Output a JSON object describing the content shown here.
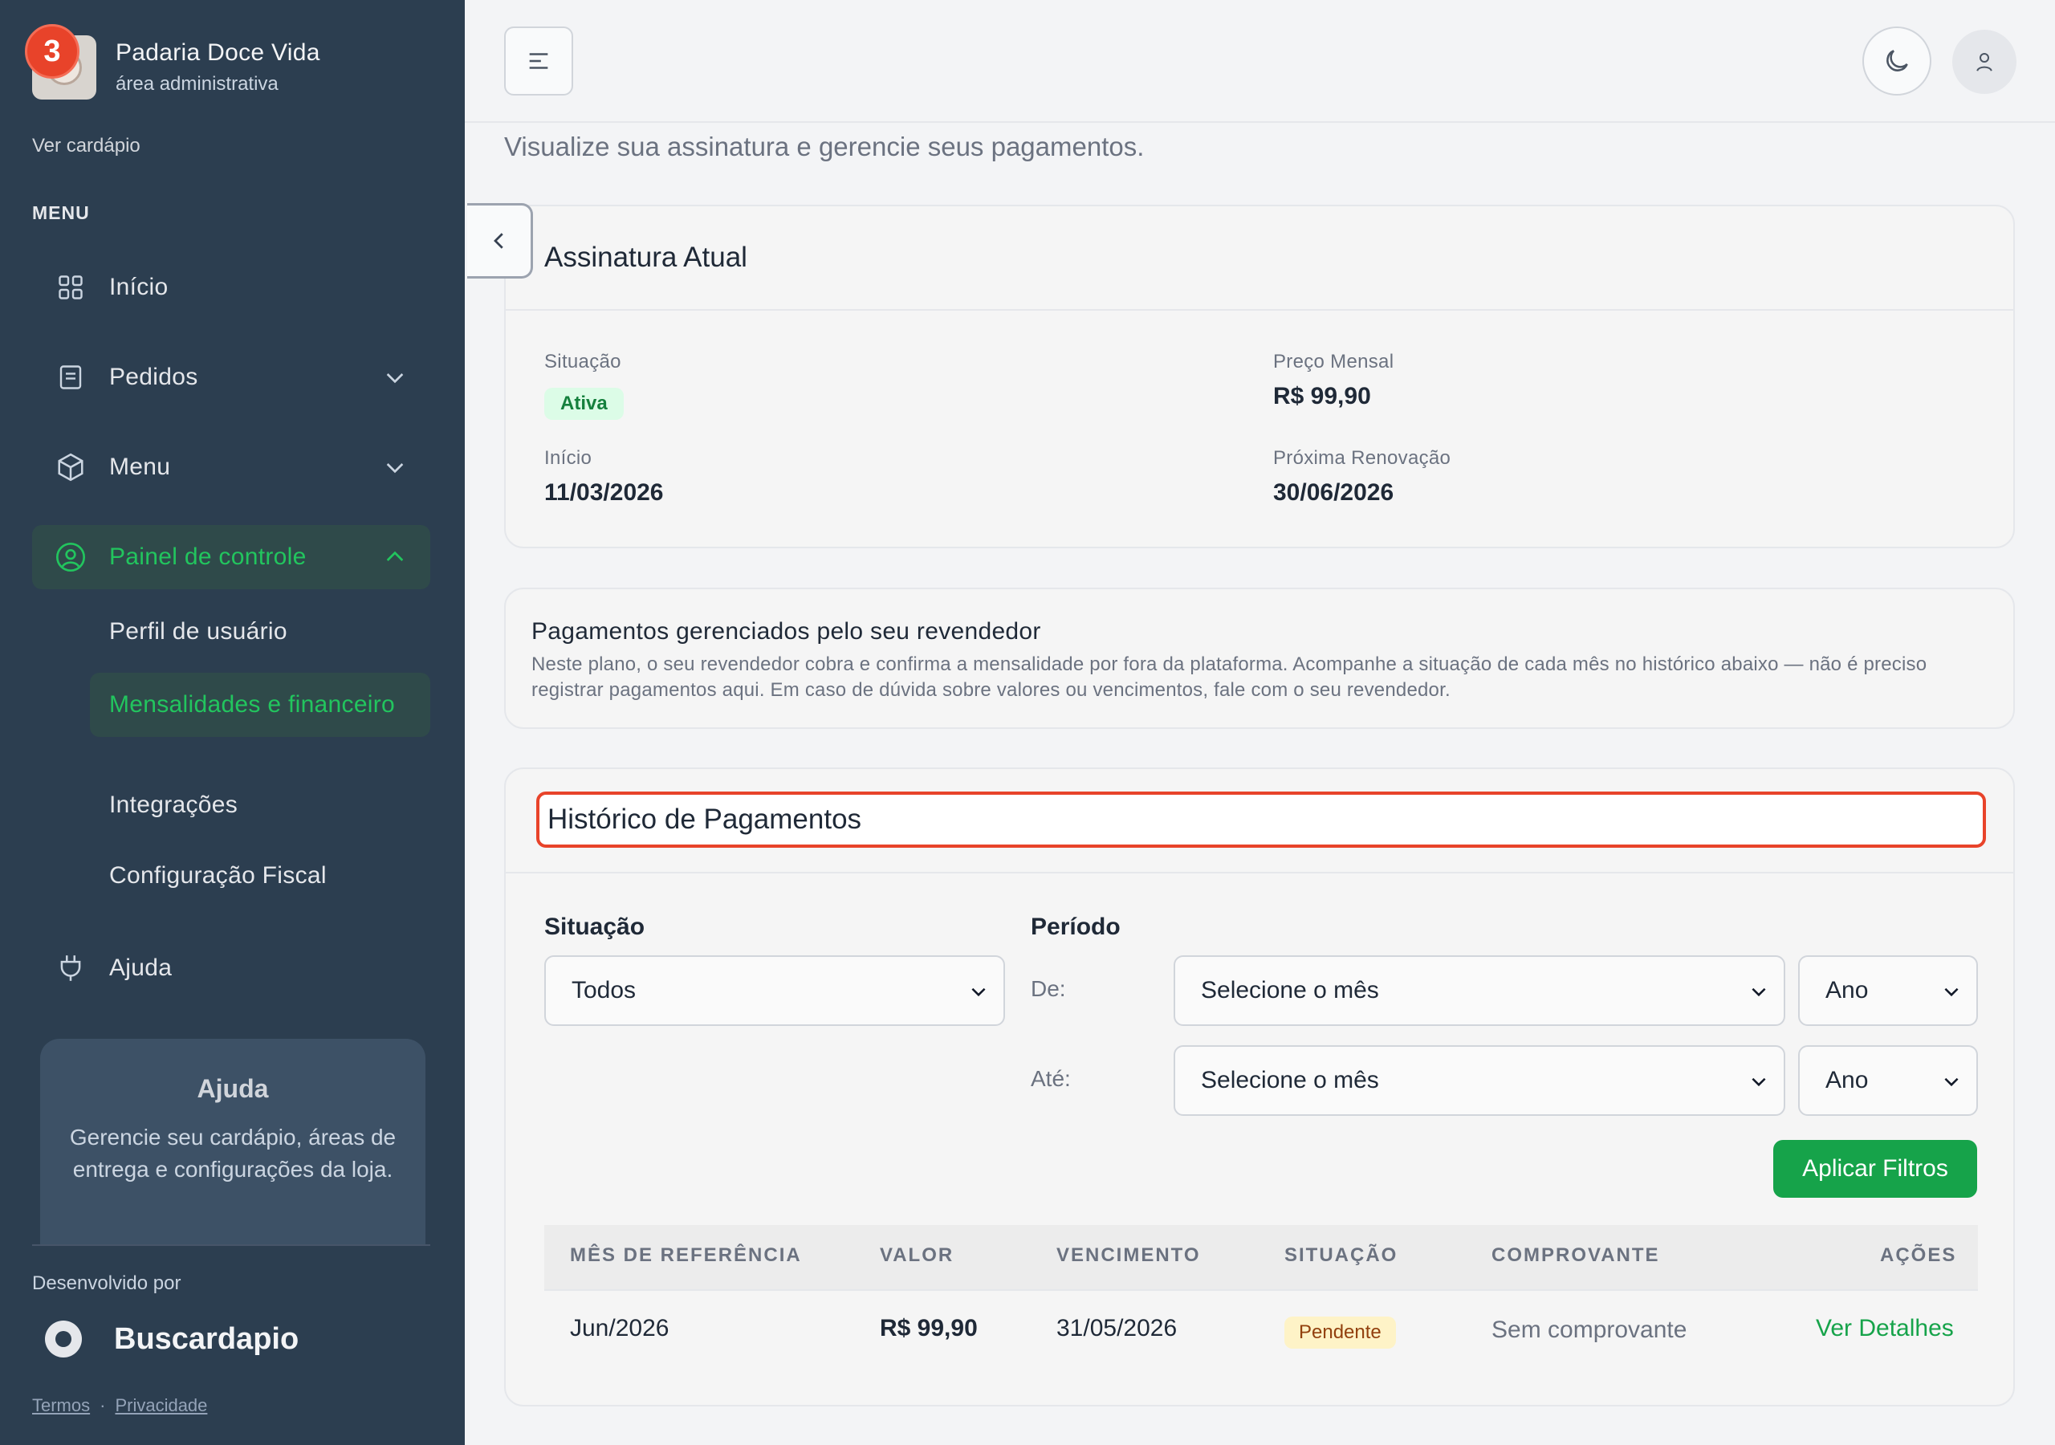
{
  "sidebar": {
    "notification_count": "3",
    "brand_name": "Padaria Doce Vida",
    "brand_subtitle": "área administrativa",
    "view_menu_link": "Ver cardápio",
    "menu_section": "MENU",
    "items": [
      {
        "label": "Início",
        "icon": "grid-icon"
      },
      {
        "label": "Pedidos",
        "icon": "receipt-icon"
      },
      {
        "label": "Menu",
        "icon": "box-icon"
      },
      {
        "label": "Painel de controle",
        "icon": "user-circle-icon"
      },
      {
        "label": "Ajuda",
        "icon": "plug-icon"
      }
    ],
    "subitems": [
      {
        "label": "Perfil de usuário"
      },
      {
        "label": "Mensalidades e financeiro"
      },
      {
        "label": "Integrações"
      },
      {
        "label": "Configuração Fiscal"
      }
    ],
    "help_title": "Ajuda",
    "help_text": "Gerencie seu cardápio, áreas de entrega e configurações da loja.",
    "developed_by": "Desenvolvido por",
    "developer_name": "Buscardapio",
    "terms": "Termos",
    "separator": "·",
    "privacy": "Privacidade"
  },
  "header": {
    "subtitle": "Visualize sua assinatura e gerencie seus pagamentos."
  },
  "subscription": {
    "title": "Assinatura Atual",
    "status_label": "Situação",
    "status_value": "Ativa",
    "price_label": "Preço Mensal",
    "price_value": "R$ 99,90",
    "start_label": "Início",
    "start_value": "11/03/2026",
    "renewal_label": "Próxima Renovação",
    "renewal_value": "30/06/2026"
  },
  "reseller": {
    "title": "Pagamentos gerenciados pelo seu revendedor",
    "text": "Neste plano, o seu revendedor cobra e confirma a mensalidade por fora da plataforma. Acompanhe a situação de cada mês no histórico abaixo — não é preciso registrar pagamentos aqui. Em caso de dúvida sobre valores ou vencimentos, fale com o seu revendedor."
  },
  "history": {
    "title": "Histórico de Pagamentos",
    "filters": {
      "status_label": "Situação",
      "status_value": "Todos",
      "period_label": "Período",
      "from_label": "De:",
      "to_label": "Até:",
      "month_placeholder": "Selecione o mês",
      "year_placeholder": "Ano",
      "apply_label": "Aplicar Filtros"
    },
    "columns": [
      "MÊS DE REFERÊNCIA",
      "VALOR",
      "VENCIMENTO",
      "SITUAÇÃO",
      "COMPROVANTE",
      "AÇÕES"
    ],
    "rows": [
      {
        "month": "Jun/2026",
        "value": "R$ 99,90",
        "due": "31/05/2026",
        "status": "Pendente",
        "receipt": "Sem comprovante",
        "action": "Ver Detalhes"
      }
    ]
  },
  "colors": {
    "sidebar_bg": "#2c3e50",
    "accent_green": "#16a34a",
    "highlight_red": "#e8432a"
  }
}
